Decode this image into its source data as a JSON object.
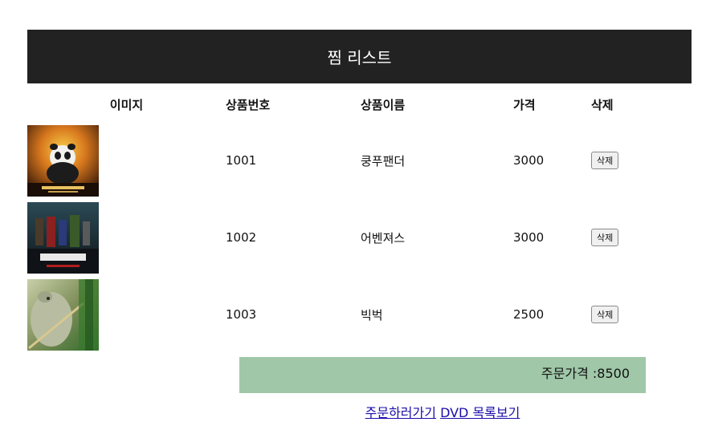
{
  "header": {
    "title": "찜 리스트"
  },
  "table": {
    "columns": [
      "이미지",
      "상품번호",
      "상품이름",
      "가격",
      "삭제"
    ],
    "rows": [
      {
        "id": "1001",
        "name": "쿵푸팬더",
        "price": "3000",
        "delete_label": "삭제",
        "poster": "kungfu-panda-poster"
      },
      {
        "id": "1002",
        "name": "어벤져스",
        "price": "3000",
        "delete_label": "삭제",
        "poster": "avengers-poster"
      },
      {
        "id": "1003",
        "name": "빅벅",
        "price": "2500",
        "delete_label": "삭제",
        "poster": "big-buck-poster"
      }
    ]
  },
  "total": {
    "label": "주문가격 :8500"
  },
  "links": {
    "order": "주문하러가기",
    "dvd_list": "DVD 목록보기"
  },
  "colors": {
    "header_bg": "#222222",
    "total_bg": "#9fc7a8",
    "link": "#1a0dab"
  }
}
